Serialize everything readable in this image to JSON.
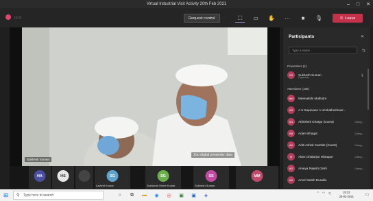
{
  "window": {
    "title": "Virtual Industrial Visit Activity 20th Feb 2021",
    "controls": [
      "–",
      "□",
      "✕"
    ]
  },
  "toolbar": {
    "meeting_time": "15:32",
    "request_control": "Request control",
    "icons": [
      "share-screen-icon",
      "chat-icon",
      "raise-hand-icon",
      "more-icon",
      "camera-icon",
      "mic-icon",
      "share-tray-icon"
    ],
    "leave_label": "Leave"
  },
  "stage": {
    "speaker_name": "Sukhesh Suman",
    "caption": "Zoo digital presenter data"
  },
  "tiles": [
    {
      "initials": "HA",
      "name": "",
      "color": "#4a4fa0"
    },
    {
      "initials": "HS",
      "name": "",
      "color": "#e6e6e6",
      "text": "#333"
    },
    {
      "initials": "",
      "name": "",
      "color": "#444"
    },
    {
      "initials": "SG",
      "name": "Lavleet Kumar",
      "color": "#5ea4ce"
    },
    {
      "initials": "SG",
      "name": "Sushanta Shree Kumar",
      "color": "#6ab04c"
    },
    {
      "initials": "SS",
      "name": "Sukhesh Suman",
      "color": "#c04ba0"
    },
    {
      "initials": "MM",
      "name": "",
      "color": "#c04b6a"
    }
  ],
  "participants": {
    "title": "Participants",
    "search_placeholder": "Type a name",
    "presenters_label": "Presenters (1)",
    "presenters": [
      {
        "initials": "SS",
        "name": "Sukhesh Suman",
        "role": "Organizer"
      }
    ],
    "attendees_label": "Attendees (185)",
    "attendees": [
      {
        "initials": "MM",
        "name": "Meenakshi Malhotra",
        "tag": ""
      },
      {
        "initials": "AS",
        "name": "A S Sapavaen A Venkatheshwar...",
        "tag": ""
      },
      {
        "initials": "AG",
        "name": "Abhishek Ghatge (Guest)",
        "tag": "Categ..."
      },
      {
        "initials": "AB",
        "name": "Adam Bhagat",
        "tag": "Categ..."
      },
      {
        "initials": "AK",
        "name": "Aditi Ashok Kamble (Guest)",
        "tag": "Categ..."
      },
      {
        "initials": "AI",
        "name": "Alam Ghalanjur Ishtaque",
        "tag": "Categ..."
      },
      {
        "initials": "AD",
        "name": "Ameya Rajesh Desh",
        "tag": "Categ..."
      },
      {
        "initials": "AD",
        "name": "Amol Satish Dusalla",
        "tag": ""
      }
    ]
  },
  "taskbar": {
    "search_placeholder": "Type here to search",
    "time": "15:32",
    "date": "20-02-2021"
  }
}
